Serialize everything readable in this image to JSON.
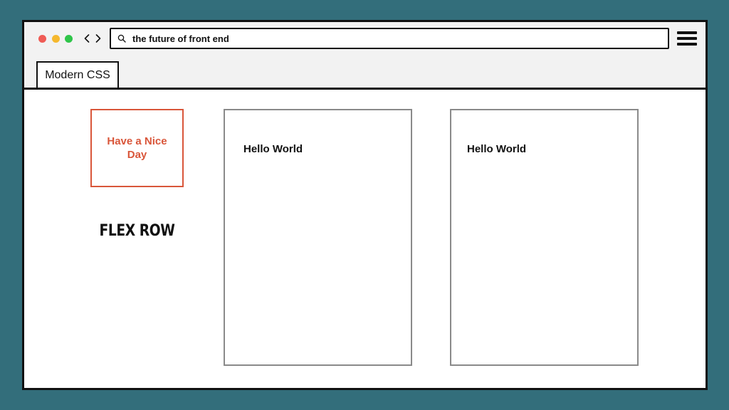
{
  "browser": {
    "window_controls": {
      "close_color": "#ef5b55",
      "minimize_color": "#f5b82e",
      "maximize_color": "#2fc54a"
    },
    "nav": {
      "back_icon": "chevron-left-icon",
      "forward_icon": "chevron-right-icon"
    },
    "address_bar": {
      "icon": "search-icon",
      "value": "the future of front end"
    },
    "menu_icon": "hamburger-menu-icon",
    "tabs": [
      {
        "label": "Modern CSS",
        "active": true
      }
    ]
  },
  "content": {
    "highlight_box": {
      "text": "Have a Nice Day",
      "color": "#d9563a"
    },
    "layout_label": "FLEX ROW",
    "cards": [
      {
        "text": "Hello World"
      },
      {
        "text": "Hello World"
      }
    ]
  },
  "colors": {
    "background": "#336e7b",
    "card_border": "#8a8a8a",
    "frame": "#111111"
  }
}
